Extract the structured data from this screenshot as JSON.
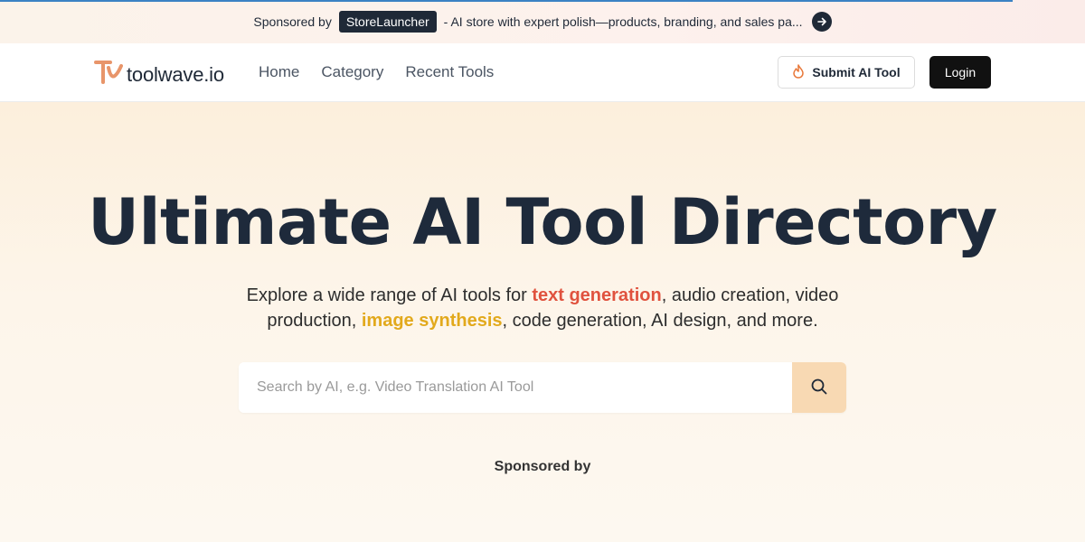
{
  "sponsor_bar": {
    "prefix": "Sponsored by",
    "brand": "StoreLauncher",
    "description": "- AI store with expert polish—products, branding, and sales pa..."
  },
  "header": {
    "logo_text": "toolwave.io",
    "nav": [
      {
        "label": "Home"
      },
      {
        "label": "Category"
      },
      {
        "label": "Recent Tools"
      }
    ],
    "submit_label": "Submit AI Tool",
    "login_label": "Login"
  },
  "hero": {
    "title": "Ultimate AI Tool Directory",
    "subtitle_part1": "Explore a wide range of AI tools for ",
    "highlight1": "text generation",
    "subtitle_part2": ", audio creation, video production, ",
    "highlight2": "image synthesis",
    "subtitle_part3": ", code generation, AI design, and more.",
    "search_placeholder": "Search by AI, e.g. Video Translation AI Tool",
    "search_value": "",
    "sponsored_label": "Sponsored by"
  },
  "colors": {
    "accent_red": "#e0523e",
    "accent_yellow": "#e2a91c",
    "search_button": "#f8d9b3",
    "logo_orange": "#e8956a",
    "dark": "#1e2a3b"
  },
  "icons": {
    "arrow": "arrow-right-icon",
    "logo": "toolwave-logo-icon",
    "fire": "fire-icon",
    "search": "search-icon"
  }
}
